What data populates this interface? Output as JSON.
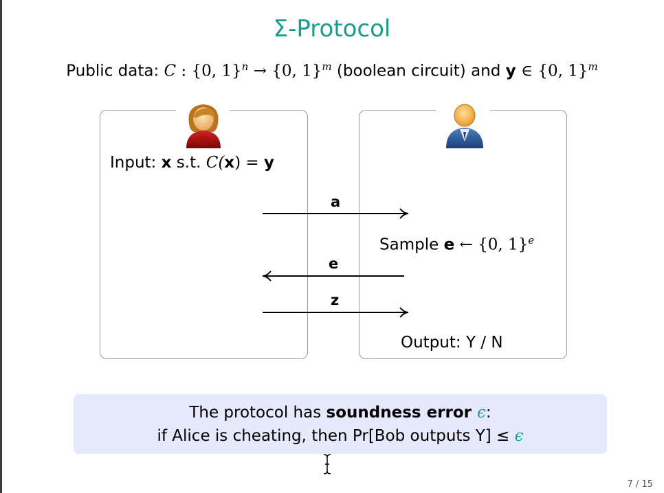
{
  "slide": {
    "title": "Σ-Protocol",
    "public_data": {
      "prefix": "Public data: ",
      "circuit": "C",
      "domain": " : {0, 1}",
      "n": "n",
      "arrow": " → {0, 1}",
      "m": "m",
      "desc": " (boolean circuit) and ",
      "y": "y",
      "member": " ∈ {0, 1}",
      "m2": "m"
    },
    "alice": {
      "input_label": "Input: ",
      "x": "x",
      "st": " s.t. ",
      "cx_pre": "C(",
      "cx_x": "x",
      "cx_post": ") = ",
      "y": "y"
    },
    "bob": {
      "sample_label": "Sample ",
      "e": "e",
      "sample_rest": " ← {0, 1}",
      "e_sup": "e",
      "output": "Output:  Y / N"
    },
    "messages": {
      "a": "a",
      "e": "e",
      "z": "z"
    },
    "callout": {
      "line1_pre": "The protocol has ",
      "line1_bold": "soundness error ",
      "line1_eps": "ϵ",
      "line1_post": ":",
      "line2_pre": "if Alice is cheating, then Pr[Bob outputs Y] ≤ ",
      "line2_eps": "ϵ"
    },
    "page_number": "7 / 15",
    "colors": {
      "accent": "#1a9c8c",
      "callout_bg": "#e6e8fb"
    }
  }
}
